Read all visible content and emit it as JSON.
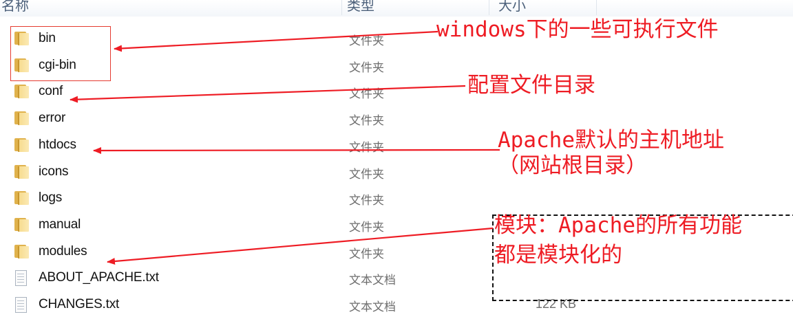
{
  "header": {
    "col_name": "名称",
    "col_type": "类型",
    "col_size": "大小"
  },
  "files": [
    {
      "name": "bin",
      "type": "文件夹",
      "size": "",
      "icon": "folder-icon"
    },
    {
      "name": "cgi-bin",
      "type": "文件夹",
      "size": "",
      "icon": "folder-icon"
    },
    {
      "name": "conf",
      "type": "文件夹",
      "size": "",
      "icon": "folder-icon"
    },
    {
      "name": "error",
      "type": "文件夹",
      "size": "",
      "icon": "folder-icon"
    },
    {
      "name": "htdocs",
      "type": "文件夹",
      "size": "",
      "icon": "folder-icon"
    },
    {
      "name": "icons",
      "type": "文件夹",
      "size": "",
      "icon": "folder-icon"
    },
    {
      "name": "logs",
      "type": "文件夹",
      "size": "",
      "icon": "folder-icon"
    },
    {
      "name": "manual",
      "type": "文件夹",
      "size": "",
      "icon": "folder-icon"
    },
    {
      "name": "modules",
      "type": "文件夹",
      "size": "",
      "icon": "folder-icon"
    },
    {
      "name": "ABOUT_APACHE.txt",
      "type": "文本文档",
      "size": "",
      "icon": "text-file-icon"
    },
    {
      "name": "CHANGES.txt",
      "type": "文本文档",
      "size": "122 KB",
      "icon": "text-file-icon"
    }
  ],
  "annotations": {
    "bin": "windows下的一些可执行文件",
    "conf": "配置文件目录",
    "htdocs_line1": "Apache默认的主机地址",
    "htdocs_line2": "（网站根目录）",
    "modules_line1": "模块：Apache的所有功能",
    "modules_line2": "都是模块化的"
  },
  "colors": {
    "annotation": "#ee1c24",
    "folder": "#e0b24c",
    "header_text": "#4c607a"
  }
}
